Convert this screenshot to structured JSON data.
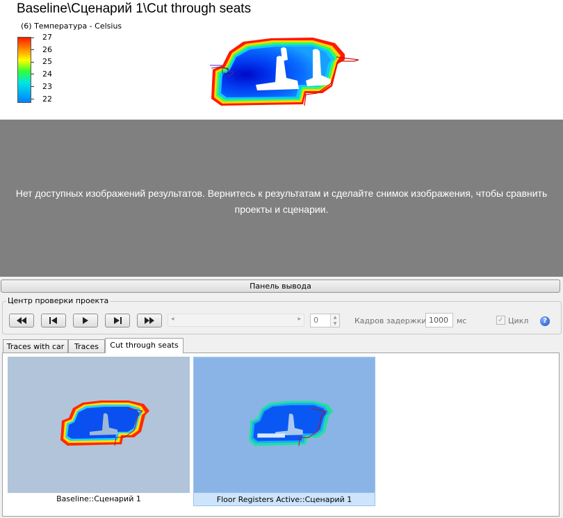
{
  "result": {
    "title": "Baseline\\Сценарий 1\\Cut through seats",
    "legend": {
      "label": "(6) Температура - Celsius",
      "ticks": [
        "27",
        "26",
        "25",
        "24",
        "23",
        "22"
      ]
    }
  },
  "viewer": {
    "message": "Нет доступных изображений результатов. Вернитесь к результатам и сделайте снимок изображения, чтобы сравнить проекты и сценарии."
  },
  "output_panel": {
    "label": "Панель вывода"
  },
  "review": {
    "group_label": "Центр проверки проекта",
    "frame": "0",
    "delay_label": "Кадров задержки:",
    "delay_value": "1000",
    "delay_unit": "мс",
    "loop_label": "Цикл",
    "loop_checked": true
  },
  "tabs": [
    {
      "label": "Traces with car",
      "active": false
    },
    {
      "label": "Traces",
      "active": false
    },
    {
      "label": "Cut through seats",
      "active": true
    }
  ],
  "thumbnails": [
    {
      "caption": "Baseline::Сценарий 1",
      "selected": false
    },
    {
      "caption": "Floor Registers Active::Сценарий 1",
      "selected": true
    }
  ],
  "colors": {
    "viewer_bg": "#808080",
    "thumb_bg_1": "#b1c4d9",
    "thumb_bg_2": "#8ab3e6",
    "selection": "#cde4fb"
  }
}
